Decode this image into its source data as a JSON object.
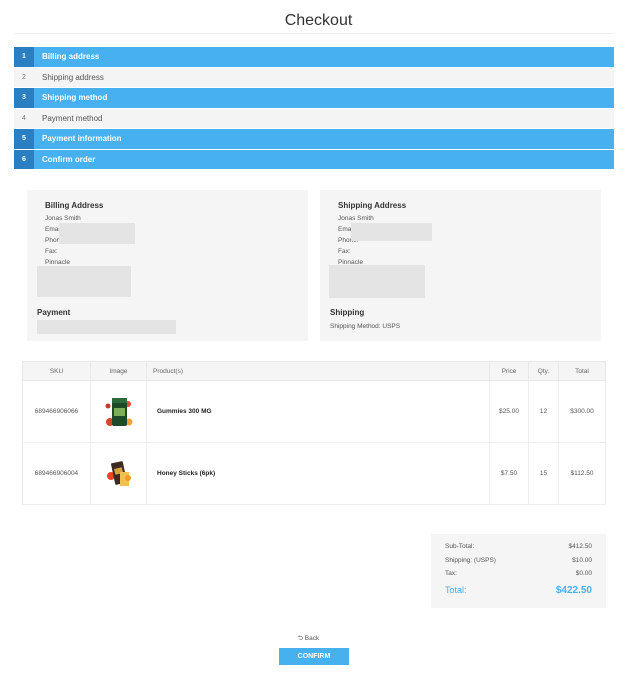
{
  "page": {
    "title": "Checkout"
  },
  "steps": [
    {
      "num": "1",
      "label": "Billing address"
    },
    {
      "num": "2",
      "label": "Shipping address"
    },
    {
      "num": "3",
      "label": "Shipping method"
    },
    {
      "num": "4",
      "label": "Payment method"
    },
    {
      "num": "5",
      "label": "Payment information"
    },
    {
      "num": "6",
      "label": "Confirm order"
    }
  ],
  "billing": {
    "heading": "Billing Address",
    "name": "Jonas Smith",
    "email_label": "Email:",
    "phone_label": "Phone:",
    "fax_label": "Fax:",
    "city": "Pinnacle",
    "payment_heading": "Payment"
  },
  "shipping": {
    "heading": "Shipping Address",
    "name": "Jonas Smith",
    "email_label": "Email:",
    "phone_label": "Phone:",
    "fax_label": "Fax:",
    "city": "Pinnacle",
    "method_heading": "Shipping",
    "method_text": "Shipping Method: USPS"
  },
  "table": {
    "headers": {
      "sku": "SKU",
      "image": "Image",
      "product": "Product(s)",
      "price": "Price",
      "qty": "Qty.",
      "total": "Total"
    },
    "rows": [
      {
        "sku": "689466906066",
        "product": "Gummies 300 MG",
        "price": "$25.00",
        "qty": "12",
        "total": "$300.00"
      },
      {
        "sku": "689466906004",
        "product": "Honey Sticks (6pk)",
        "price": "$7.50",
        "qty": "15",
        "total": "$112.50"
      }
    ]
  },
  "totals": {
    "subtotal_label": "Sub-Total:",
    "subtotal": "$412.50",
    "shipping_label": "Shipping: (USPS)",
    "shipping": "$10.00",
    "tax_label": "Tax:",
    "tax": "$0.00",
    "total_label": "Total:",
    "total": "$422.50"
  },
  "actions": {
    "back_label": "Back",
    "confirm_label": "CONFIRM"
  },
  "colors": {
    "accent": "#47b0ef",
    "accent_dark": "#2a7fc2"
  }
}
